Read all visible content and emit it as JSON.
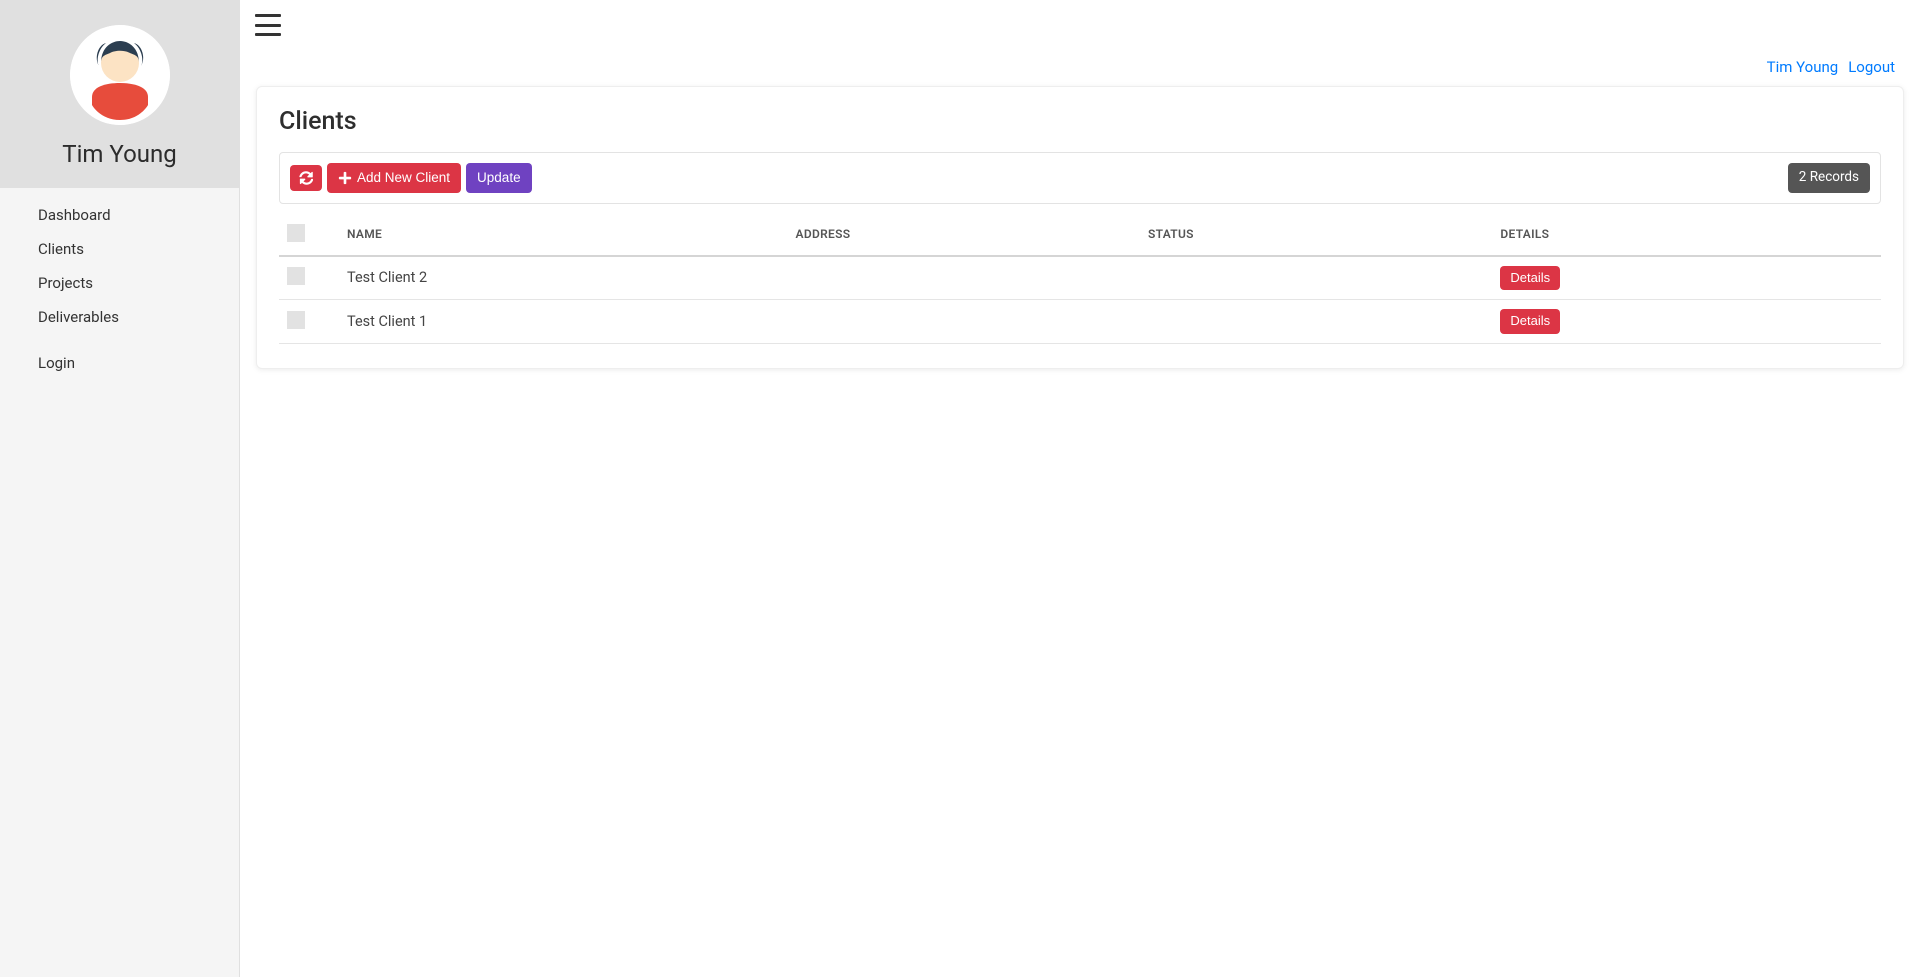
{
  "sidebar": {
    "name": "Tim Young",
    "items": [
      {
        "label": "Dashboard"
      },
      {
        "label": "Clients"
      },
      {
        "label": "Projects"
      },
      {
        "label": "Deliverables"
      }
    ],
    "secondary": [
      {
        "label": "Login"
      }
    ]
  },
  "topbar": {
    "user_link": "Tim Young",
    "logout": "Logout"
  },
  "page": {
    "title": "Clients"
  },
  "toolbar": {
    "add_label": "Add New Client",
    "update_label": "Update",
    "record_count": "2 Records"
  },
  "table": {
    "headers": {
      "name": "NAME",
      "address": "ADDRESS",
      "status": "STATUS",
      "details": "DETAILS"
    },
    "details_button": "Details",
    "rows": [
      {
        "name": "Test Client 2",
        "address": "",
        "status": ""
      },
      {
        "name": "Test Client 1",
        "address": "",
        "status": ""
      }
    ]
  }
}
